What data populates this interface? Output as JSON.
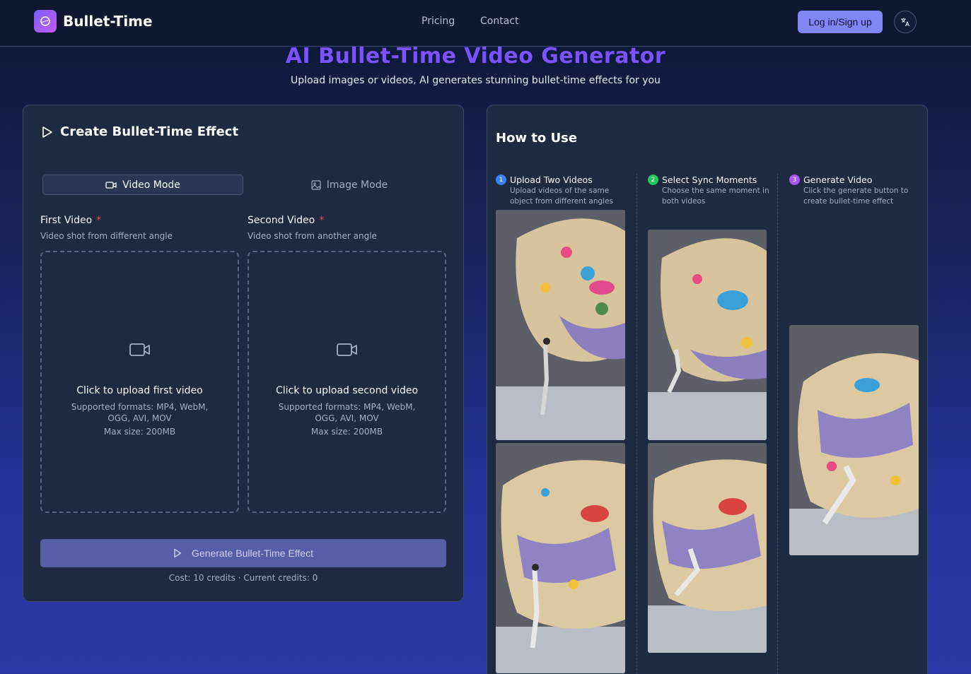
{
  "nav": {
    "brand": "Bullet-Time",
    "links": [
      "Pricing",
      "Contact"
    ],
    "login_label": "Log in/Sign up",
    "lang_icon": "translate-icon"
  },
  "hero": {
    "title": "AI Bullet-Time Video Generator",
    "subtitle": "Upload images or videos, AI generates stunning bullet-time effects for you"
  },
  "create": {
    "title": "Create Bullet-Time Effect",
    "modes": [
      "Video Mode",
      "Image Mode"
    ],
    "active_mode": "Video Mode",
    "fields": [
      {
        "label": "First Video",
        "required_mark": "*",
        "help": "Video shot from different angle",
        "upload_title": "Click to upload first video",
        "formats": "Supported formats: MP4, WebM, OGG, AVI, MOV",
        "max_size": "Max size: 200MB"
      },
      {
        "label": "Second Video",
        "required_mark": "*",
        "help": "Video shot from another angle",
        "upload_title": "Click to upload second video",
        "formats": "Supported formats: MP4, WebM, OGG, AVI, MOV",
        "max_size": "Max size: 200MB"
      }
    ],
    "generate_label": "Generate Bullet-Time Effect",
    "cost": "Cost: 10 credits · Current credits: 0"
  },
  "howto": {
    "title": "How to Use",
    "steps": [
      {
        "num": "1",
        "title": "Upload Two Videos",
        "desc": "Upload videos of the same object from different angles",
        "color": "#3b82f6"
      },
      {
        "num": "2",
        "title": "Select Sync Moments",
        "desc": "Choose the same moment in both videos",
        "color": "#22c55e"
      },
      {
        "num": "3",
        "title": "Generate Video",
        "desc": "Click the generate button to create bullet-time effect",
        "color": "#a855f7"
      }
    ]
  },
  "colors": {
    "accent": "#7a52ff",
    "button": "#7f86f6",
    "card": "#1e2942"
  }
}
